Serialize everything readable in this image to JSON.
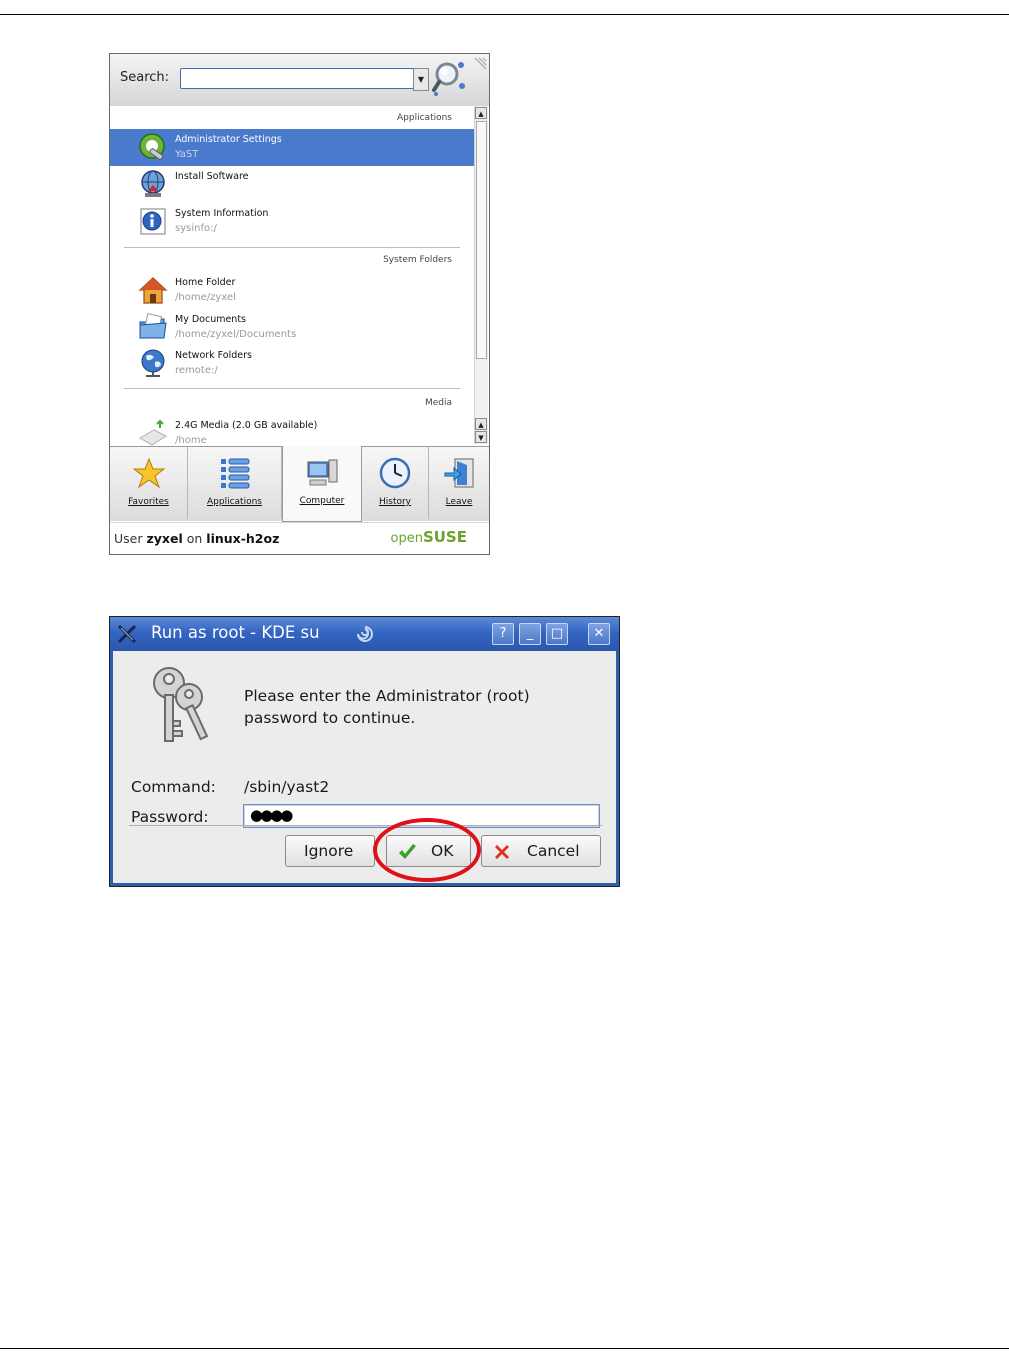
{
  "kickoff": {
    "search_label": "Search:",
    "search_value": "",
    "sections": {
      "applications": "Applications",
      "system_folders": "System Folders",
      "media": "Media"
    },
    "applications": [
      {
        "title": "Administrator Settings",
        "subtitle": "YaST",
        "icon": "yast-icon",
        "selected": true
      },
      {
        "title": "Install Software",
        "subtitle": "",
        "icon": "install-software-icon",
        "selected": false
      },
      {
        "title": "System Information",
        "subtitle": "sysinfo:/",
        "icon": "info-icon",
        "selected": false
      }
    ],
    "system_folders": [
      {
        "title": "Home Folder",
        "subtitle": "/home/zyxel",
        "icon": "home-icon"
      },
      {
        "title": "My Documents",
        "subtitle": "/home/zyxel/Documents",
        "icon": "documents-folder-icon"
      },
      {
        "title": "Network Folders",
        "subtitle": "remote:/",
        "icon": "network-globe-icon"
      }
    ],
    "media": [
      {
        "title": "2.4G Media (2.0 GB available)",
        "subtitle": "/home",
        "icon": "drive-icon"
      }
    ],
    "tabs": [
      {
        "label": "Favorites",
        "icon": "star-icon"
      },
      {
        "label": "Applications",
        "icon": "list-icon"
      },
      {
        "label": "Computer",
        "icon": "computer-icon",
        "active": true
      },
      {
        "label": "History",
        "icon": "clock-icon"
      },
      {
        "label": "Leave",
        "icon": "leave-icon"
      }
    ],
    "status": {
      "user_prefix": "User",
      "user": "zyxel",
      "on_text": "on",
      "host": "linux-h2oz",
      "logo_prefix": "open",
      "logo_main": "SUSE"
    }
  },
  "dialog": {
    "title": "Run as root - KDE su",
    "title_buttons": [
      "?",
      "_",
      "□",
      "✕"
    ],
    "message_line1": "Please enter the Administrator (root)",
    "message_line2": "password to continue.",
    "command_label": "Command:",
    "command_value": "/sbin/yast2",
    "password_label": "Password:",
    "password_mask": "●●●●",
    "buttons": {
      "ignore": "Ignore",
      "ok": "OK",
      "cancel": "Cancel"
    }
  },
  "colors": {
    "selection": "#4a7acb",
    "titlebar": "#3365c2",
    "highlight_circle": "#e0101a",
    "opensuse_green": "#6aa329"
  }
}
